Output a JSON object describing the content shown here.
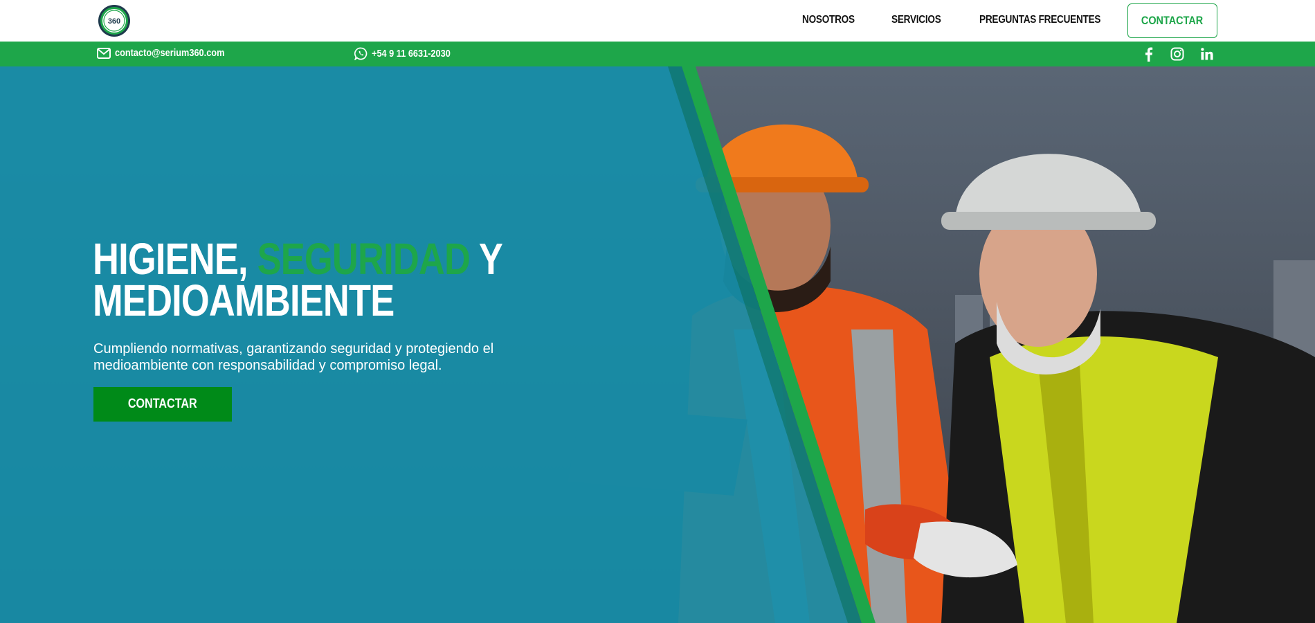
{
  "brand": {
    "logo_text": "360",
    "colors": {
      "green": "#1ea64a",
      "dark_green": "#008a18",
      "teal_overlay": "#1a8ea8"
    }
  },
  "nav": {
    "links": [
      "NOSOTROS",
      "SERVICIOS",
      "PREGUNTAS FRECUENTES"
    ],
    "cta_label": "CONTACTAR"
  },
  "contact_bar": {
    "email": "contacto@serium360.com",
    "email_icon": "envelope-icon",
    "phone": "+54 9 11 6631-2030",
    "phone_icon": "whatsapp-icon",
    "social": [
      "facebook-icon",
      "instagram-icon",
      "linkedin-icon"
    ]
  },
  "hero": {
    "title_part1": "HIGIENE, ",
    "title_accent": "SEGURIDAD",
    "title_part2": " Y",
    "title_line2": "MEDIOAMBIENTE",
    "subtitle": "Cumpliendo normativas, garantizando seguridad y protegiendo el medioambiente con responsabilidad y compromiso legal.",
    "cta_label": "CONTACTAR"
  }
}
